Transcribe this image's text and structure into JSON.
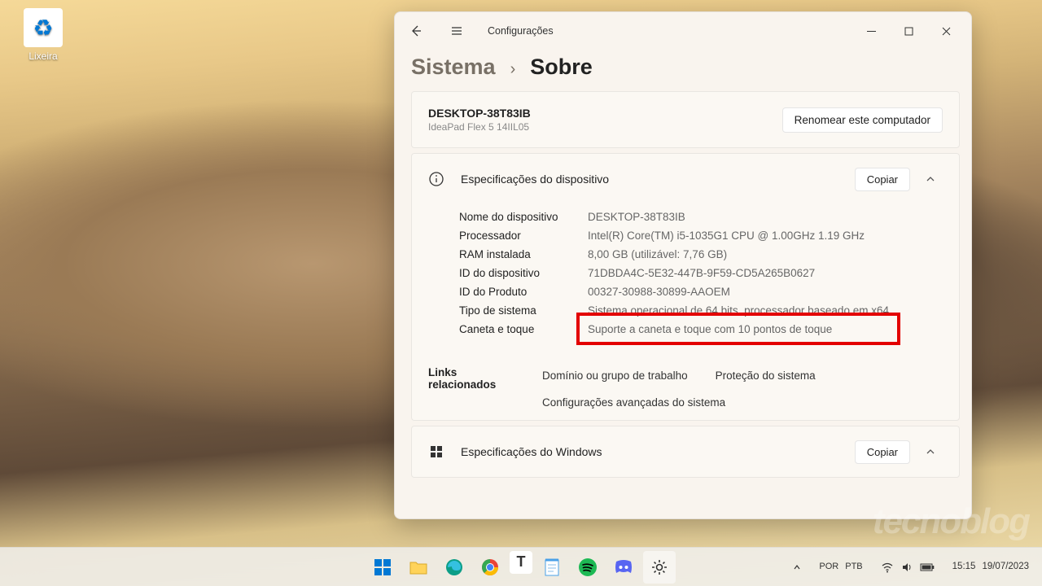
{
  "desktop": {
    "recycle_label": "Lixeira"
  },
  "window": {
    "title": "Configurações",
    "breadcrumb_parent": "Sistema",
    "breadcrumb_current": "Sobre"
  },
  "header_card": {
    "name": "DESKTOP-38T83IB",
    "model": "IdeaPad Flex 5 14IIL05",
    "rename_btn": "Renomear este computador"
  },
  "device_specs": {
    "title": "Especificações do dispositivo",
    "copy_btn": "Copiar",
    "rows": [
      {
        "label": "Nome do dispositivo",
        "value": "DESKTOP-38T83IB"
      },
      {
        "label": "Processador",
        "value": "Intel(R) Core(TM) i5-1035G1 CPU @ 1.00GHz   1.19 GHz"
      },
      {
        "label": "RAM instalada",
        "value": "8,00 GB (utilizável: 7,76 GB)"
      },
      {
        "label": "ID do dispositivo",
        "value": "71DBDA4C-5E32-447B-9F59-CD5A265B0627"
      },
      {
        "label": "ID do Produto",
        "value": "00327-30988-30899-AAOEM"
      },
      {
        "label": "Tipo de sistema",
        "value": "Sistema operacional de 64 bits, processador baseado em x64"
      },
      {
        "label": "Caneta e toque",
        "value": "Suporte a caneta e toque com 10 pontos de toque"
      }
    ]
  },
  "related": {
    "label": "Links relacionados",
    "links": [
      "Domínio ou grupo de trabalho",
      "Proteção do sistema",
      "Configurações avançadas do sistema"
    ]
  },
  "win_specs": {
    "title": "Especificações do Windows",
    "copy_btn": "Copiar"
  },
  "taskbar": {
    "lang_top": "POR",
    "lang_bot": "PTB",
    "time": "15:15",
    "date": "19/07/2023"
  },
  "watermark": "tecnoblog"
}
